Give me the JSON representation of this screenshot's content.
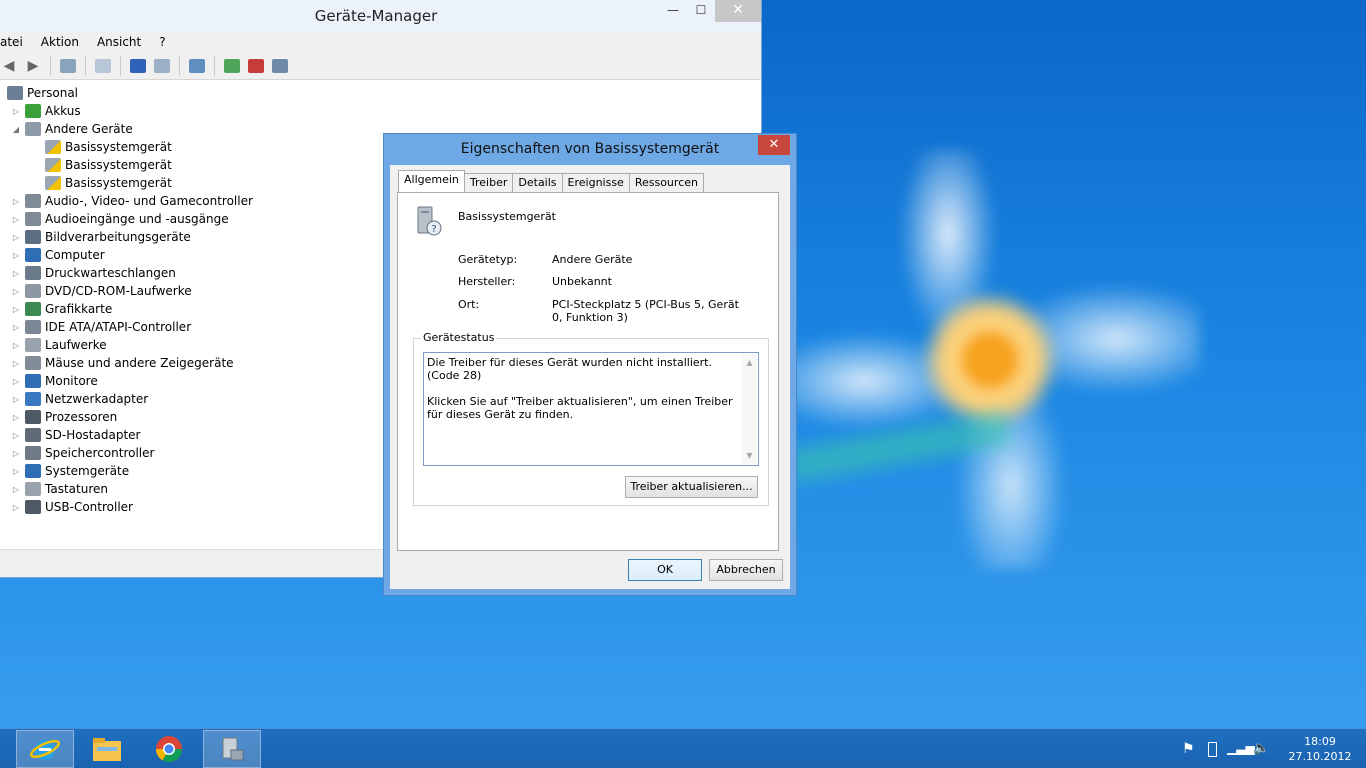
{
  "colors": {
    "desktop_blue": "#1a86e2",
    "dialog_frame": "#6ea9e6",
    "close_red": "#c9463d"
  },
  "device_manager": {
    "title": "Geräte-Manager",
    "window_buttons": {
      "minimize": "—",
      "maximize": "☐",
      "close": "✕"
    },
    "menu": [
      "atei",
      "Aktion",
      "Ansicht",
      "?"
    ],
    "tree": {
      "root": "Personal",
      "categories": [
        {
          "label": "Akkus",
          "expanded": false
        },
        {
          "label": "Andere Geräte",
          "expanded": true,
          "children": [
            "Basissystemgerät",
            "Basissystemgerät",
            "Basissystemgerät"
          ]
        },
        {
          "label": "Audio-, Video- und Gamecontroller",
          "expanded": false
        },
        {
          "label": "Audioeingänge und -ausgänge",
          "expanded": false
        },
        {
          "label": "Bildverarbeitungsgeräte",
          "expanded": false
        },
        {
          "label": "Computer",
          "expanded": false
        },
        {
          "label": "Druckwarteschlangen",
          "expanded": false
        },
        {
          "label": "DVD/CD-ROM-Laufwerke",
          "expanded": false
        },
        {
          "label": "Grafikkarte",
          "expanded": false
        },
        {
          "label": "IDE ATA/ATAPI-Controller",
          "expanded": false
        },
        {
          "label": "Laufwerke",
          "expanded": false
        },
        {
          "label": "Mäuse und andere Zeigegeräte",
          "expanded": false
        },
        {
          "label": "Monitore",
          "expanded": false
        },
        {
          "label": "Netzwerkadapter",
          "expanded": false
        },
        {
          "label": "Prozessoren",
          "expanded": false
        },
        {
          "label": "SD-Hostadapter",
          "expanded": false
        },
        {
          "label": "Speichercontroller",
          "expanded": false
        },
        {
          "label": "Systemgeräte",
          "expanded": false
        },
        {
          "label": "Tastaturen",
          "expanded": false
        },
        {
          "label": "USB-Controller",
          "expanded": false
        }
      ]
    }
  },
  "dialog": {
    "title": "Eigenschaften von Basissystemgerät",
    "close": "✕",
    "tabs": [
      "Allgemein",
      "Treiber",
      "Details",
      "Ereignisse",
      "Ressourcen"
    ],
    "device_name": "Basissystemgerät",
    "properties": {
      "type_label": "Gerätetyp:",
      "type_value": "Andere Geräte",
      "manufacturer_label": "Hersteller:",
      "manufacturer_value": "Unbekannt",
      "location_label": "Ort:",
      "location_value": "PCI-Steckplatz 5 (PCI-Bus 5, Gerät 0, Funktion 3)"
    },
    "status_group": "Gerätestatus",
    "status_line1": "Die Treiber für dieses Gerät wurden nicht installiert. (Code 28)",
    "status_line2": "Klicken Sie auf \"Treiber aktualisieren\", um einen Treiber für dieses Gerät zu finden.",
    "update_button": "Treiber aktualisieren...",
    "ok": "OK",
    "cancel": "Abbrechen"
  },
  "taskbar": {
    "apps": [
      "internet-explorer-icon",
      "file-explorer-icon",
      "chrome-icon",
      "device-manager-icon"
    ],
    "time": "18:09",
    "date": "27.10.2012"
  }
}
